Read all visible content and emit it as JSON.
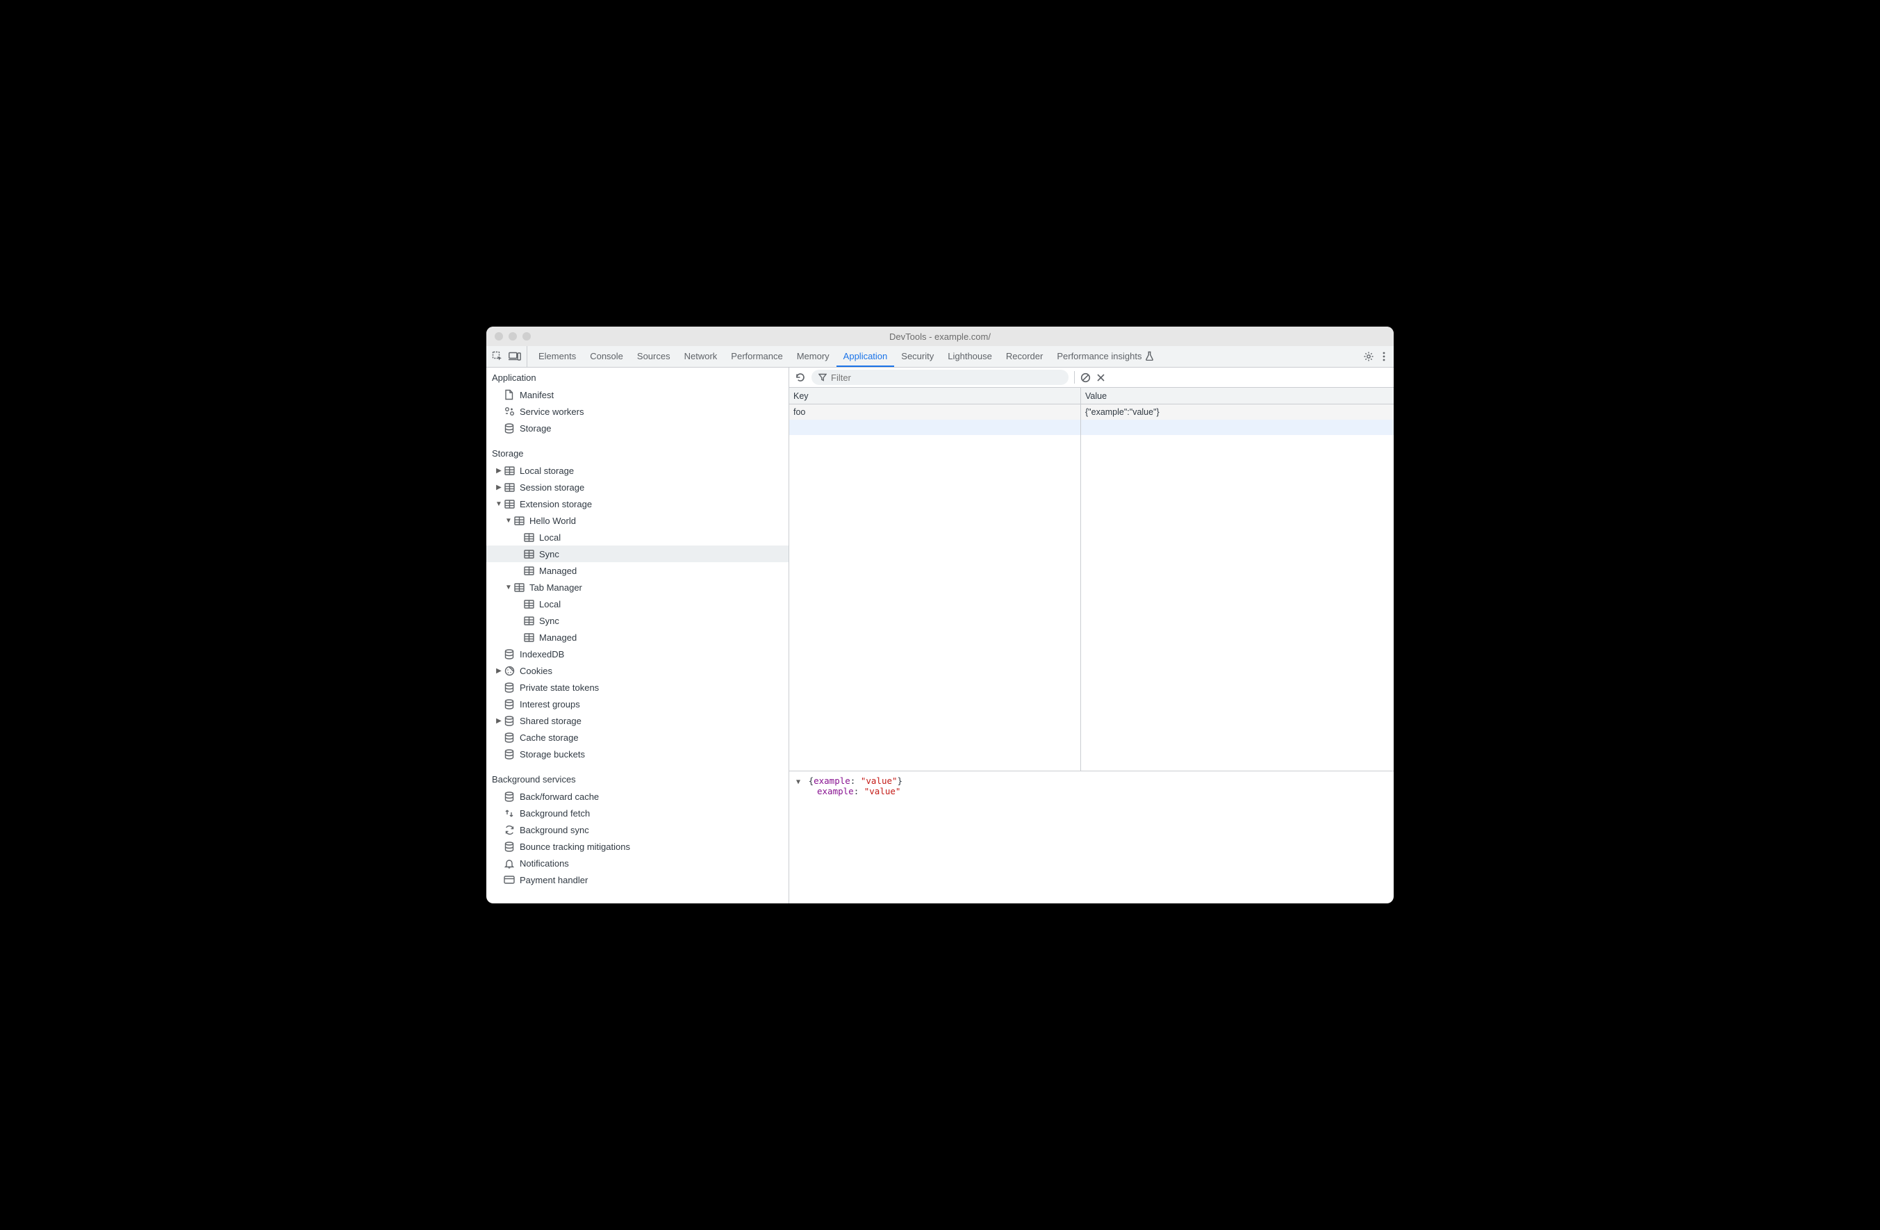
{
  "window_title": "DevTools - example.com/",
  "tabs": {
    "items": [
      "Elements",
      "Console",
      "Sources",
      "Network",
      "Performance",
      "Memory",
      "Application",
      "Security",
      "Lighthouse",
      "Recorder",
      "Performance insights"
    ],
    "active": "Application",
    "insights_has_icon": true
  },
  "toolbar": {
    "filter_placeholder": "Filter"
  },
  "sidebar": {
    "s0": {
      "title": "Application",
      "items": [
        {
          "label": "Manifest",
          "icon": "file"
        },
        {
          "label": "Service workers",
          "icon": "service"
        },
        {
          "label": "Storage",
          "icon": "db"
        }
      ]
    },
    "s1": {
      "title": "Storage",
      "items": [
        {
          "label": "Local storage",
          "icon": "grid",
          "arrow": "right",
          "depth": 0
        },
        {
          "label": "Session storage",
          "icon": "grid",
          "arrow": "right",
          "depth": 0
        },
        {
          "label": "Extension storage",
          "icon": "grid",
          "arrow": "down",
          "depth": 0
        },
        {
          "label": "Hello World",
          "icon": "grid",
          "arrow": "down",
          "depth": 1
        },
        {
          "label": "Local",
          "icon": "grid",
          "depth": 2
        },
        {
          "label": "Sync",
          "icon": "grid",
          "depth": 2,
          "selected": true
        },
        {
          "label": "Managed",
          "icon": "grid",
          "depth": 2
        },
        {
          "label": "Tab Manager",
          "icon": "grid",
          "arrow": "down",
          "depth": 1
        },
        {
          "label": "Local",
          "icon": "grid",
          "depth": 2
        },
        {
          "label": "Sync",
          "icon": "grid",
          "depth": 2
        },
        {
          "label": "Managed",
          "icon": "grid",
          "depth": 2
        },
        {
          "label": "IndexedDB",
          "icon": "db",
          "depth": 0
        },
        {
          "label": "Cookies",
          "icon": "cookie",
          "arrow": "right",
          "depth": 0
        },
        {
          "label": "Private state tokens",
          "icon": "db",
          "depth": 0
        },
        {
          "label": "Interest groups",
          "icon": "db",
          "depth": 0
        },
        {
          "label": "Shared storage",
          "icon": "db",
          "arrow": "right",
          "depth": 0
        },
        {
          "label": "Cache storage",
          "icon": "db",
          "depth": 0
        },
        {
          "label": "Storage buckets",
          "icon": "db",
          "depth": 0
        }
      ]
    },
    "s2": {
      "title": "Background services",
      "items": [
        {
          "label": "Back/forward cache",
          "icon": "db"
        },
        {
          "label": "Background fetch",
          "icon": "fetch"
        },
        {
          "label": "Background sync",
          "icon": "sync"
        },
        {
          "label": "Bounce tracking mitigations",
          "icon": "db"
        },
        {
          "label": "Notifications",
          "icon": "bell"
        },
        {
          "label": "Payment handler",
          "icon": "card"
        }
      ]
    }
  },
  "table": {
    "headers": {
      "key": "Key",
      "value": "Value"
    },
    "rows": [
      {
        "key": "foo",
        "value": "{\"example\":\"value\"}"
      }
    ]
  },
  "detail": {
    "summary_pre": "{",
    "summary_key": "example",
    "summary_sep": ": ",
    "summary_val": "\"value\"",
    "summary_post": "}",
    "prop_key": "example",
    "prop_sep": ": ",
    "prop_val": "\"value\""
  }
}
